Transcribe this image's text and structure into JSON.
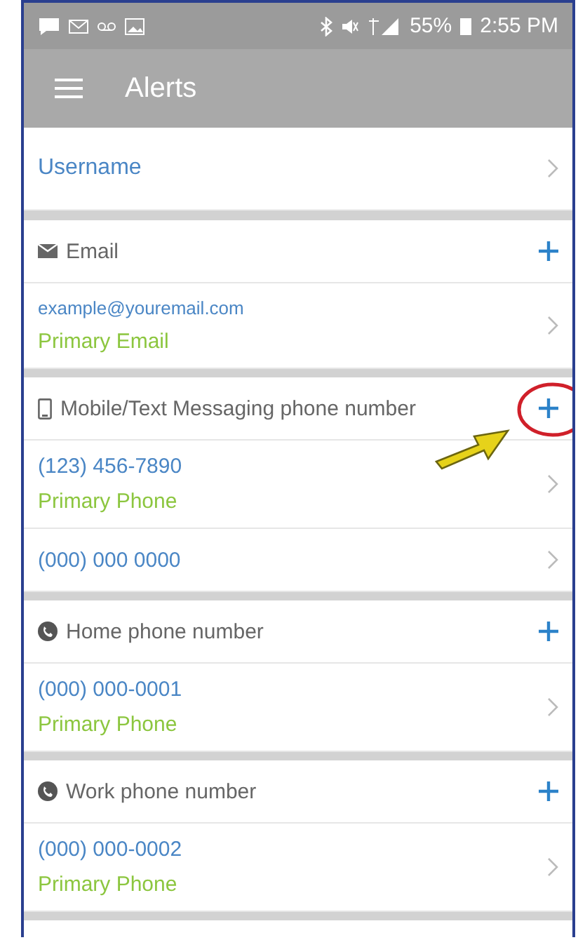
{
  "status_bar": {
    "battery": "55%",
    "time": "2:55 PM"
  },
  "app_bar": {
    "title": "Alerts"
  },
  "username_row": {
    "label": "Username"
  },
  "sections": [
    {
      "kind": "email",
      "title": "Email",
      "highlighted": false,
      "entries": [
        {
          "value": "example@youremail.com",
          "label": "Primary Email"
        }
      ]
    },
    {
      "kind": "mobile",
      "title": "Mobile/Text Messaging phone number",
      "highlighted": true,
      "entries": [
        {
          "value": "(123) 456-7890",
          "label": "Primary Phone"
        },
        {
          "value": "(000) 000 0000"
        }
      ]
    },
    {
      "kind": "phone",
      "title": "Home phone number",
      "highlighted": false,
      "entries": [
        {
          "value": "(000) 000-0001",
          "label": "Primary Phone"
        }
      ]
    },
    {
      "kind": "phone",
      "title": "Work phone number",
      "highlighted": false,
      "entries": [
        {
          "value": "(000) 000-0002",
          "label": "Primary Phone"
        }
      ]
    }
  ]
}
